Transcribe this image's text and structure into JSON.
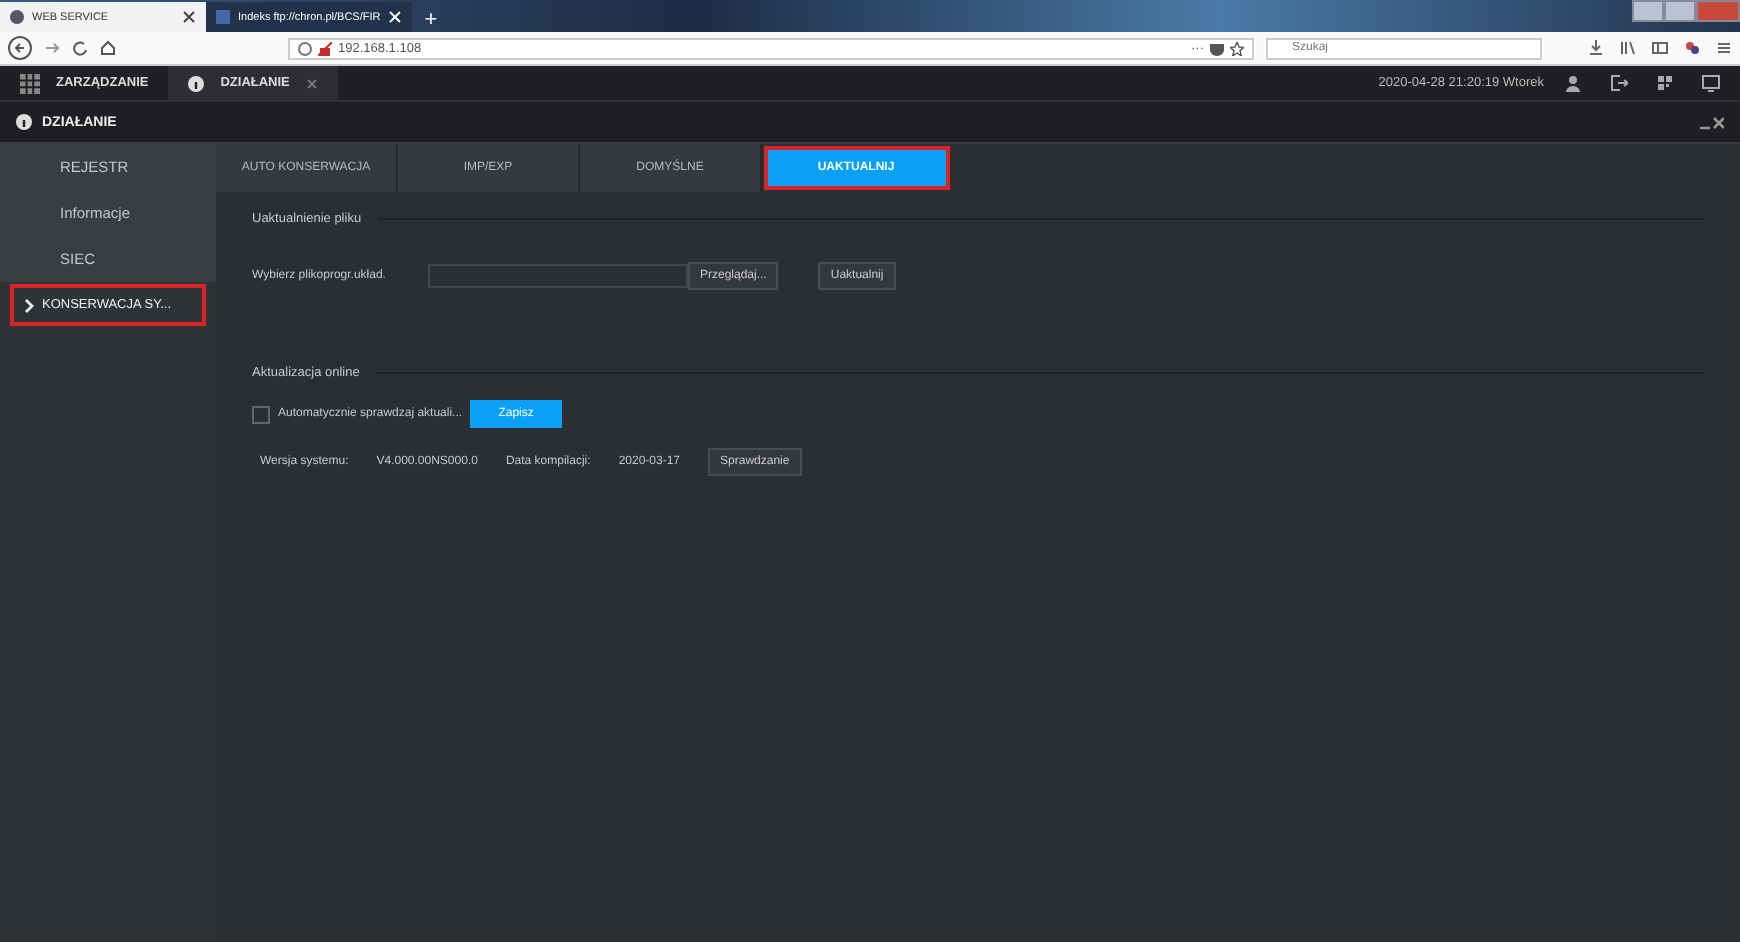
{
  "browser": {
    "tabs": [
      {
        "title": "WEB SERVICE",
        "selected": true
      },
      {
        "title": "Indeks ftp://chron.pl/BCS/FIR",
        "selected": false
      }
    ],
    "new_tab": "+",
    "url": "192.168.1.108",
    "more": "···",
    "search": {
      "placeholder": "Szukaj"
    }
  },
  "app_bar": {
    "tabs": [
      {
        "label": "ZARZĄDZANIE",
        "kind": "grid",
        "selected": false,
        "closable": false
      },
      {
        "label": "DZIAŁANIE",
        "kind": "info",
        "selected": true,
        "closable": true
      }
    ],
    "datetime": "2020-04-28 21:20:19 Wtorek"
  },
  "panel": {
    "title": "DZIAŁANIE"
  },
  "sidebar": {
    "items": [
      {
        "label": "REJESTR",
        "selected": false,
        "highlighted": false
      },
      {
        "label": "Informacje",
        "selected": false,
        "highlighted": false
      },
      {
        "label": "SIEC",
        "selected": false,
        "highlighted": false
      },
      {
        "label": "KONSERWACJA SY...",
        "selected": true,
        "highlighted": true
      }
    ]
  },
  "tabs": [
    {
      "label": "AUTO KONSERWACJA",
      "selected": false,
      "highlighted": false
    },
    {
      "label": "IMP/EXP",
      "selected": false,
      "highlighted": false
    },
    {
      "label": "DOMYŚLNE",
      "selected": false,
      "highlighted": false
    },
    {
      "label": "UAKTUALNIJ",
      "selected": true,
      "highlighted": true
    }
  ],
  "file_update": {
    "heading": "Uaktualnienie pliku",
    "label": "Wybierz plikoprogr.układ.",
    "browse_button": "Przeglądaj...",
    "update_button": "Uaktualnij"
  },
  "online_update": {
    "heading": "Aktualizacja online",
    "auto_check": {
      "label": "Automatycznie sprawdzaj aktuali...",
      "checked": false
    },
    "save_button": "Zapisz",
    "version_label": "Wersja systemu:",
    "version": "V4.000.00NS000.0",
    "build_label": "Data kompilacji:",
    "build_date": "2020-03-17",
    "check_button": "Sprawdzanie"
  }
}
